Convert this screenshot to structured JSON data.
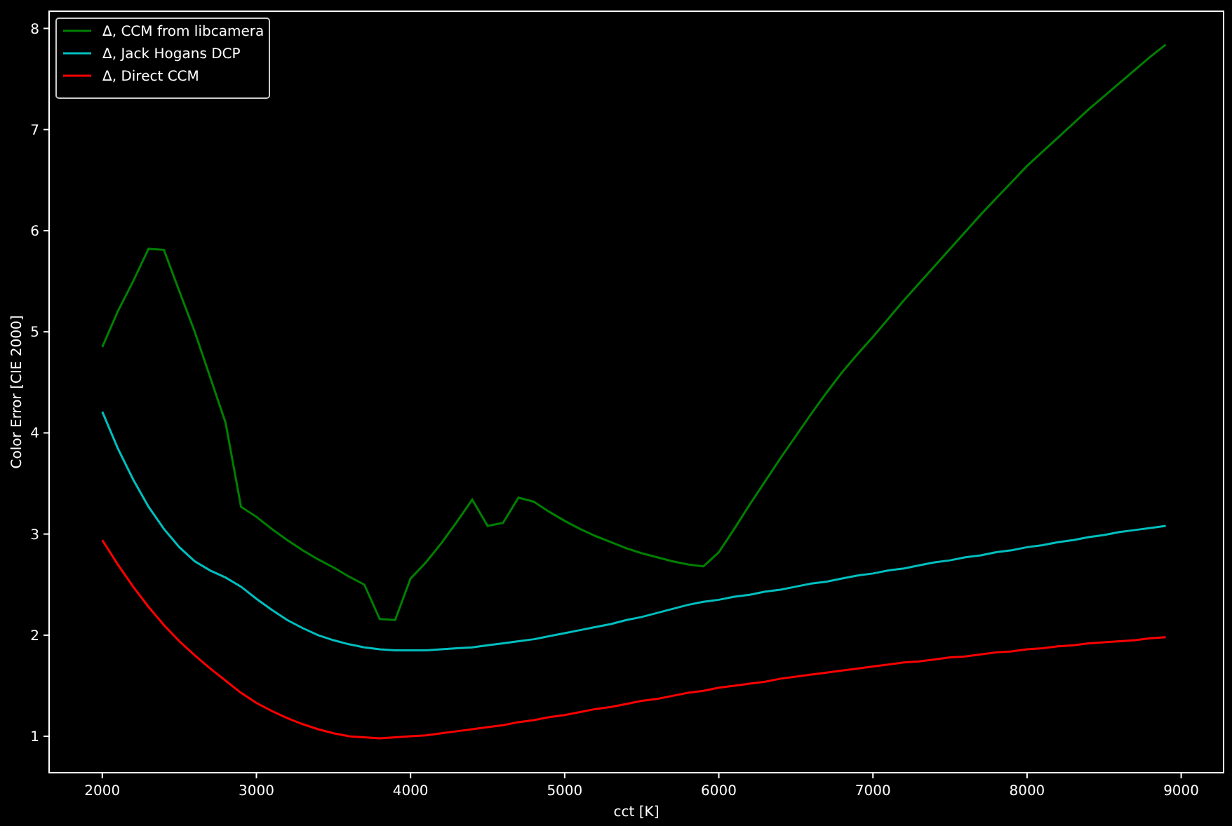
{
  "chart_data": {
    "type": "line",
    "xlabel": "cct [K]",
    "ylabel": "Color Error [CIE 2000]",
    "x": [
      2000,
      2100,
      2200,
      2300,
      2400,
      2500,
      2600,
      2700,
      2800,
      2900,
      3000,
      3100,
      3200,
      3300,
      3400,
      3500,
      3600,
      3700,
      3800,
      3900,
      4000,
      4100,
      4200,
      4300,
      4400,
      4500,
      4600,
      4700,
      4800,
      4900,
      5000,
      5100,
      5200,
      5300,
      5400,
      5500,
      5600,
      5700,
      5800,
      5900,
      6000,
      6100,
      6200,
      6300,
      6400,
      6500,
      6600,
      6700,
      6800,
      6900,
      7000,
      7100,
      7200,
      7300,
      7400,
      7500,
      7600,
      7700,
      7800,
      7900,
      8000,
      8100,
      8200,
      8300,
      8400,
      8500,
      8600,
      8700,
      8800,
      8900
    ],
    "series": [
      {
        "name": "Δ, CCM from libcamera",
        "color": "#008000",
        "values": [
          4.85,
          5.2,
          5.5,
          5.82,
          5.81,
          5.4,
          5.0,
          4.55,
          4.1,
          3.27,
          3.17,
          3.05,
          2.94,
          2.84,
          2.75,
          2.67,
          2.58,
          2.5,
          2.16,
          2.15,
          2.56,
          2.72,
          2.91,
          3.12,
          3.34,
          3.08,
          3.11,
          3.36,
          3.32,
          3.22,
          3.13,
          3.05,
          2.98,
          2.92,
          2.86,
          2.81,
          2.77,
          2.73,
          2.7,
          2.68,
          2.82,
          3.05,
          3.29,
          3.52,
          3.75,
          3.97,
          4.19,
          4.4,
          4.6,
          4.78,
          4.95,
          5.13,
          5.31,
          5.48,
          5.65,
          5.82,
          5.99,
          6.16,
          6.32,
          6.48,
          6.64,
          6.78,
          6.92,
          7.06,
          7.2,
          7.33,
          7.46,
          7.59,
          7.72,
          7.84
        ]
      },
      {
        "name": "Δ, Jack Hogans DCP",
        "color": "#00bfbf",
        "values": [
          4.21,
          3.85,
          3.54,
          3.27,
          3.05,
          2.87,
          2.73,
          2.64,
          2.57,
          2.48,
          2.36,
          2.25,
          2.15,
          2.07,
          2.0,
          1.95,
          1.91,
          1.88,
          1.86,
          1.85,
          1.85,
          1.85,
          1.86,
          1.87,
          1.88,
          1.9,
          1.92,
          1.94,
          1.96,
          1.99,
          2.02,
          2.05,
          2.08,
          2.11,
          2.15,
          2.18,
          2.22,
          2.26,
          2.3,
          2.33,
          2.35,
          2.38,
          2.4,
          2.43,
          2.45,
          2.48,
          2.51,
          2.53,
          2.56,
          2.59,
          2.61,
          2.64,
          2.66,
          2.69,
          2.72,
          2.74,
          2.77,
          2.79,
          2.82,
          2.84,
          2.87,
          2.89,
          2.92,
          2.94,
          2.97,
          2.99,
          3.02,
          3.04,
          3.06,
          3.08
        ]
      },
      {
        "name": "Δ, Direct CCM",
        "color": "#ff0000",
        "values": [
          2.94,
          2.7,
          2.48,
          2.28,
          2.1,
          1.94,
          1.8,
          1.67,
          1.55,
          1.43,
          1.33,
          1.25,
          1.18,
          1.12,
          1.07,
          1.03,
          1.0,
          0.99,
          0.98,
          0.99,
          1.0,
          1.01,
          1.03,
          1.05,
          1.07,
          1.09,
          1.11,
          1.14,
          1.16,
          1.19,
          1.21,
          1.24,
          1.27,
          1.29,
          1.32,
          1.35,
          1.37,
          1.4,
          1.43,
          1.45,
          1.48,
          1.5,
          1.52,
          1.54,
          1.57,
          1.59,
          1.61,
          1.63,
          1.65,
          1.67,
          1.69,
          1.71,
          1.73,
          1.74,
          1.76,
          1.78,
          1.79,
          1.81,
          1.83,
          1.84,
          1.86,
          1.87,
          1.89,
          1.9,
          1.92,
          1.93,
          1.94,
          1.95,
          1.97,
          1.98
        ]
      }
    ],
    "xlim": [
      1655,
      9275
    ],
    "ylim": [
      0.64,
      8.17
    ],
    "xticks": [
      2000,
      3000,
      4000,
      5000,
      6000,
      7000,
      8000,
      9000
    ],
    "yticks": [
      1,
      2,
      3,
      4,
      5,
      6,
      7,
      8
    ],
    "legend": true
  }
}
